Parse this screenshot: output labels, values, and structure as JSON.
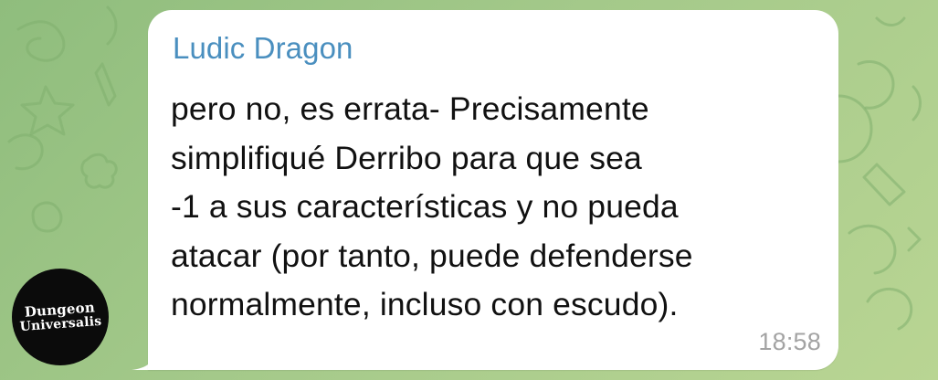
{
  "colors": {
    "background": "#9cc484",
    "bubble": "#ffffff",
    "sender_name": "#4a8fbf",
    "message_text": "#111111",
    "timestamp": "#a3a3a3",
    "avatar_background": "#0b0b0b"
  },
  "avatar": {
    "logo_lines": [
      "Dungeon",
      "Universalis"
    ]
  },
  "message": {
    "sender": "Ludic Dragon",
    "lines": [
      "pero no, es errata- Precisamente",
      "simplifiqué Derribo para que sea",
      "-1 a sus características y no pueda",
      "atacar (por tanto, puede defenderse",
      "normalmente, incluso con escudo)."
    ],
    "time": "18:58"
  }
}
